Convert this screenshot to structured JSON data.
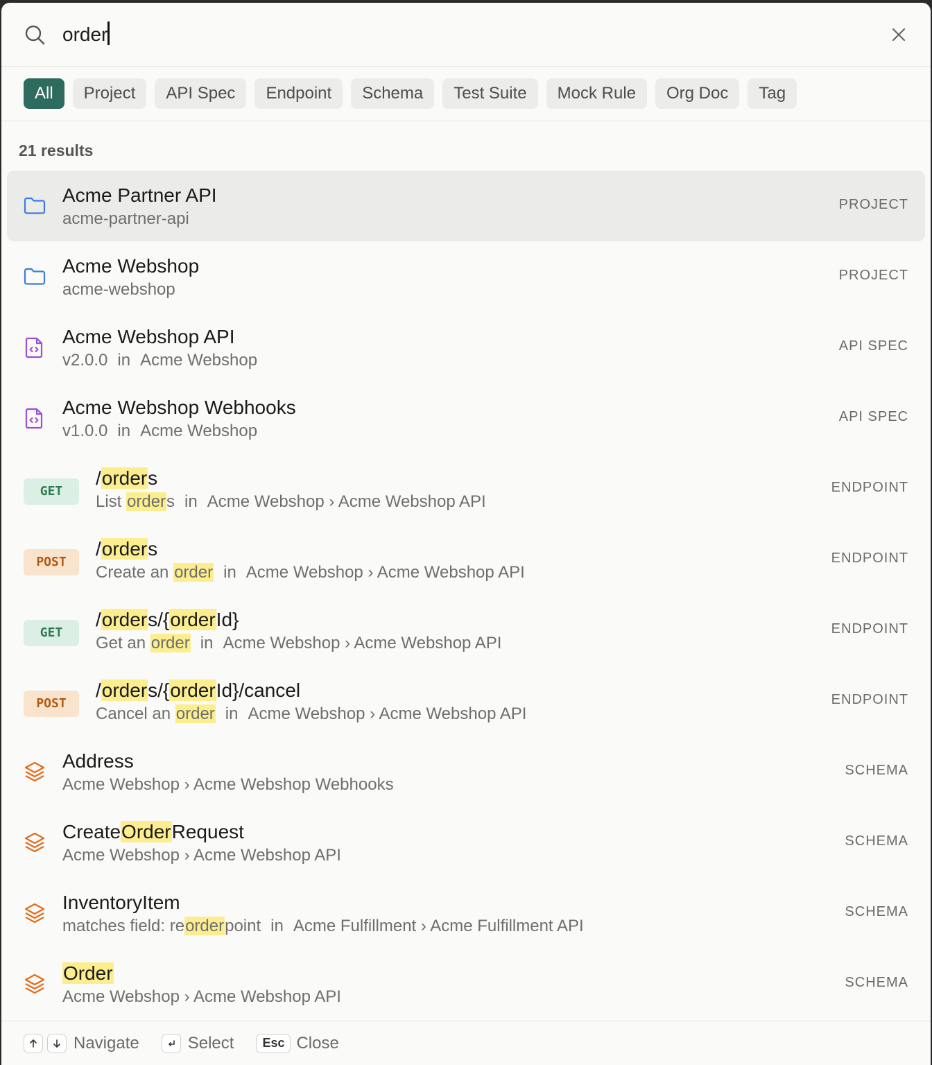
{
  "search": {
    "value": "order"
  },
  "filters": [
    "All",
    "Project",
    "API Spec",
    "Endpoint",
    "Schema",
    "Test Suite",
    "Mock Rule",
    "Org Doc",
    "Tag"
  ],
  "active_filter": "All",
  "result_count": "21 results",
  "accent_color": "#2e6b5f",
  "highlight_color": "#fcee8e",
  "results": [
    {
      "type": "project",
      "icon": "folder-icon",
      "title": [
        [
          "Acme Partner API",
          false
        ]
      ],
      "subtitle": [
        [
          "acme-partner-api",
          false
        ]
      ],
      "kind": "PROJECT",
      "selected": true
    },
    {
      "type": "project",
      "icon": "folder-icon",
      "title": [
        [
          "Acme Webshop",
          false
        ]
      ],
      "subtitle": [
        [
          "acme-webshop",
          false
        ]
      ],
      "kind": "PROJECT"
    },
    {
      "type": "spec",
      "icon": "file-code-icon",
      "title": [
        [
          "Acme Webshop API",
          false
        ]
      ],
      "subtitle": [
        [
          "v2.0.0",
          false
        ]
      ],
      "context": "Acme Webshop",
      "kind": "API SPEC"
    },
    {
      "type": "spec",
      "icon": "file-code-icon",
      "title": [
        [
          "Acme Webshop Webhooks",
          false
        ]
      ],
      "subtitle": [
        [
          "v1.0.0",
          false
        ]
      ],
      "context": "Acme Webshop",
      "kind": "API SPEC"
    },
    {
      "type": "endpoint",
      "method": "GET",
      "title": [
        [
          "/",
          false
        ],
        [
          "order",
          true
        ],
        [
          "s",
          false
        ]
      ],
      "subtitle": [
        [
          "List ",
          false
        ],
        [
          "order",
          true
        ],
        [
          "s",
          false
        ]
      ],
      "context": "Acme Webshop › Acme Webshop API",
      "kind": "ENDPOINT"
    },
    {
      "type": "endpoint",
      "method": "POST",
      "title": [
        [
          "/",
          false
        ],
        [
          "order",
          true
        ],
        [
          "s",
          false
        ]
      ],
      "subtitle": [
        [
          "Create an ",
          false
        ],
        [
          "order",
          true
        ]
      ],
      "context": "Acme Webshop › Acme Webshop API",
      "kind": "ENDPOINT"
    },
    {
      "type": "endpoint",
      "method": "GET",
      "title": [
        [
          "/",
          false
        ],
        [
          "order",
          true
        ],
        [
          "s/{",
          false
        ],
        [
          "order",
          true
        ],
        [
          "Id}",
          false
        ]
      ],
      "subtitle": [
        [
          "Get an ",
          false
        ],
        [
          "order",
          true
        ]
      ],
      "context": "Acme Webshop › Acme Webshop API",
      "kind": "ENDPOINT"
    },
    {
      "type": "endpoint",
      "method": "POST",
      "title": [
        [
          "/",
          false
        ],
        [
          "order",
          true
        ],
        [
          "s/{",
          false
        ],
        [
          "order",
          true
        ],
        [
          "Id}/cancel",
          false
        ]
      ],
      "subtitle": [
        [
          "Cancel an ",
          false
        ],
        [
          "order",
          true
        ]
      ],
      "context": "Acme Webshop › Acme Webshop API",
      "kind": "ENDPOINT"
    },
    {
      "type": "schema",
      "icon": "layers-icon",
      "title": [
        [
          "Address",
          false
        ]
      ],
      "subtitle": [
        [
          "Acme Webshop › Acme Webshop Webhooks",
          false
        ]
      ],
      "kind": "SCHEMA"
    },
    {
      "type": "schema",
      "icon": "layers-icon",
      "title": [
        [
          "Create",
          false
        ],
        [
          "Order",
          true
        ],
        [
          "Request",
          false
        ]
      ],
      "subtitle": [
        [
          "Acme Webshop › Acme Webshop API",
          false
        ]
      ],
      "kind": "SCHEMA"
    },
    {
      "type": "schema",
      "icon": "layers-icon",
      "title": [
        [
          "InventoryItem",
          false
        ]
      ],
      "subtitle": [
        [
          "matches field: re",
          false
        ],
        [
          "order",
          true
        ],
        [
          "point",
          false
        ]
      ],
      "context": "Acme Fulfillment › Acme Fulfillment API",
      "kind": "SCHEMA"
    },
    {
      "type": "schema",
      "icon": "layers-icon",
      "title": [
        [
          "Order",
          true
        ]
      ],
      "subtitle": [
        [
          "Acme Webshop › Acme Webshop API",
          false
        ]
      ],
      "kind": "SCHEMA"
    }
  ],
  "context_separator": "in",
  "footer": {
    "navigate_label": "Navigate",
    "select_label": "Select",
    "esc_key": "Esc",
    "close_label": "Close"
  }
}
